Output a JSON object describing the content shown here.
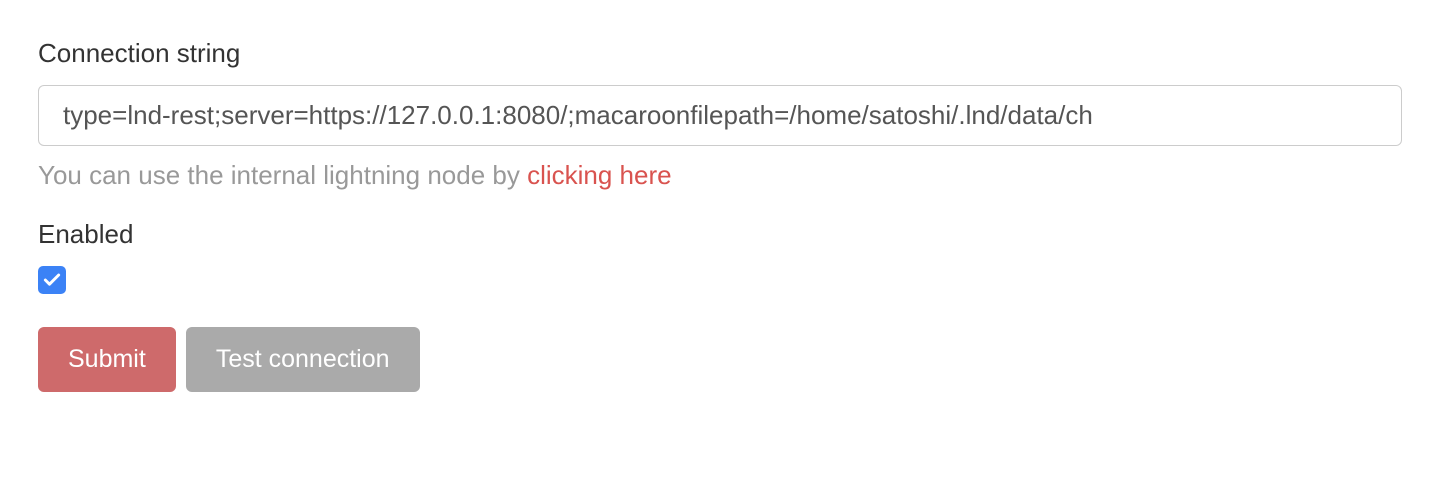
{
  "form": {
    "connection_string": {
      "label": "Connection string",
      "value": "type=lnd-rest;server=https://127.0.0.1:8080/;macaroonfilepath=/home/satoshi/.lnd/data/ch",
      "help_prefix": "You can use the internal lightning node by ",
      "help_link": "clicking here"
    },
    "enabled": {
      "label": "Enabled",
      "checked": true
    },
    "buttons": {
      "submit": "Submit",
      "test_connection": "Test connection"
    }
  }
}
